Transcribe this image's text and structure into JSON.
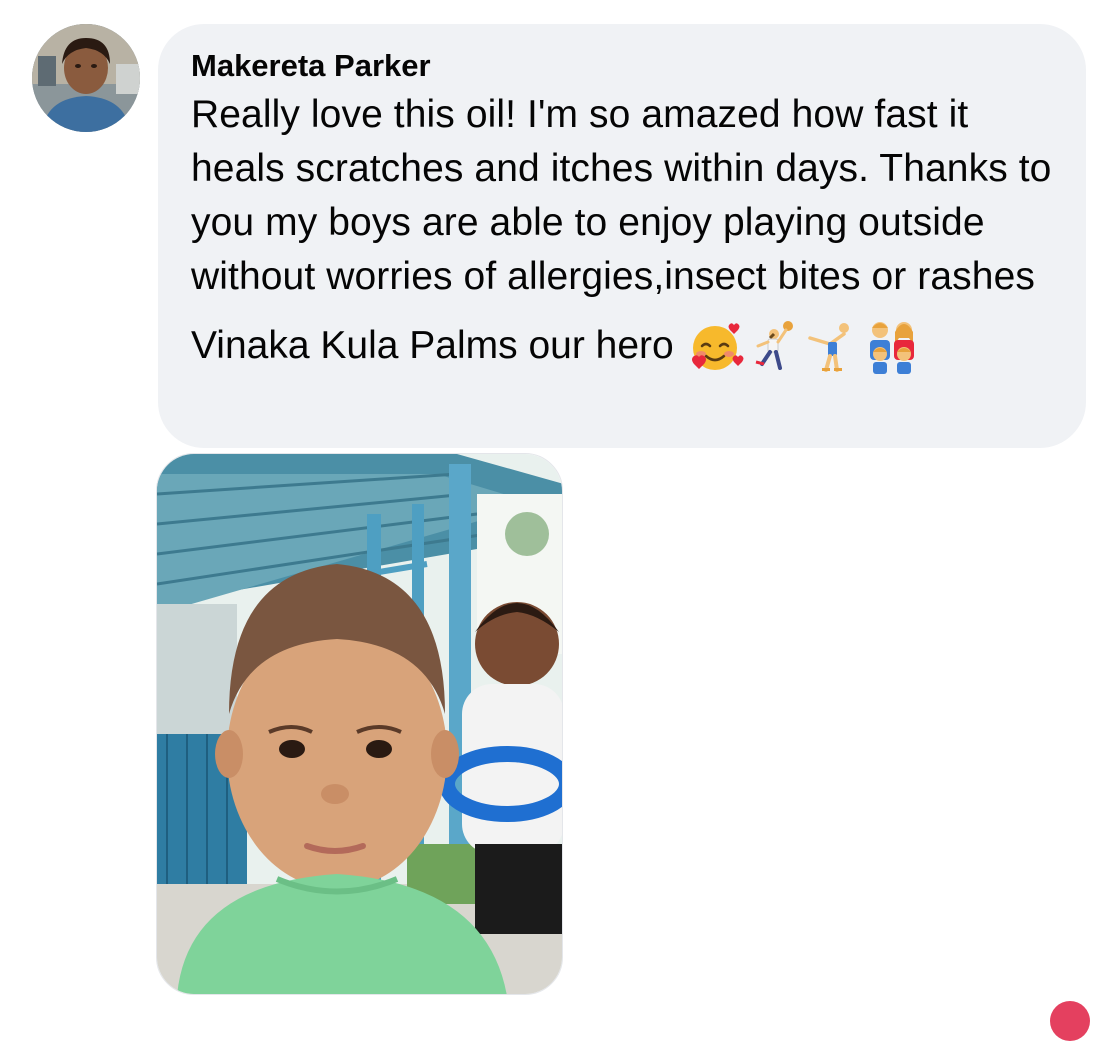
{
  "comment": {
    "author": "Makereta Parker",
    "body": "Really love this oil! I'm so amazed how fast it heals scratches and itches within days. Thanks to you my boys are able to enjoy playing outside without worries of allergies,insect bites or rashes",
    "closing": "Vinaka Kula Palms our hero",
    "emojis": [
      "smiling-face-with-hearts",
      "person-playing-handball",
      "person-cartwheeling",
      "family"
    ]
  },
  "attachment": {
    "type": "photo",
    "content": "two boys outdoors"
  },
  "colors": {
    "bubble_background": "#f0f2f5",
    "text": "#050505",
    "notification_dot": "#e4405f"
  }
}
